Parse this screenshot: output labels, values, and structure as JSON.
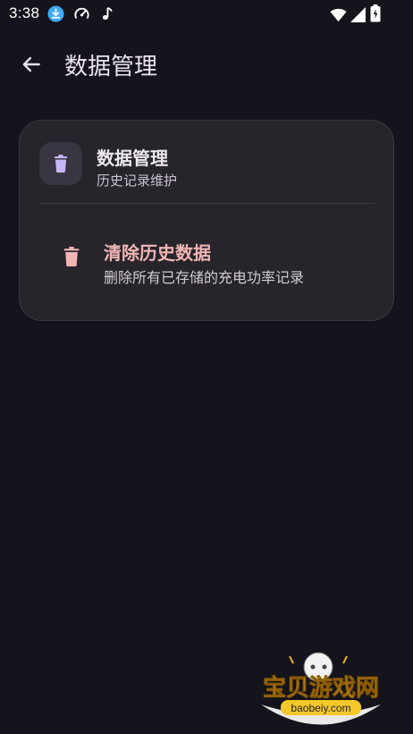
{
  "status_bar": {
    "time": "3:38",
    "icons": [
      "download-icon",
      "speedometer-icon",
      "music-note-icon",
      "wifi-icon",
      "signal-icon",
      "battery-icon"
    ]
  },
  "app_bar": {
    "back_icon": "arrow-back-icon",
    "title": "数据管理"
  },
  "card": {
    "icon": "trash-icon",
    "title": "数据管理",
    "subtitle": "历史记录维护",
    "action": {
      "icon": "trash-icon",
      "title": "清除历史数据",
      "subtitle": "删除所有已存储的充电功率记录"
    }
  },
  "watermark": {
    "text": "宝贝游戏网",
    "url": "baobeiy.com"
  },
  "colors": {
    "background": "#15131b",
    "card": "#27242c",
    "accent_purple": "#c8b6f5",
    "danger": "#f0b6b3"
  }
}
